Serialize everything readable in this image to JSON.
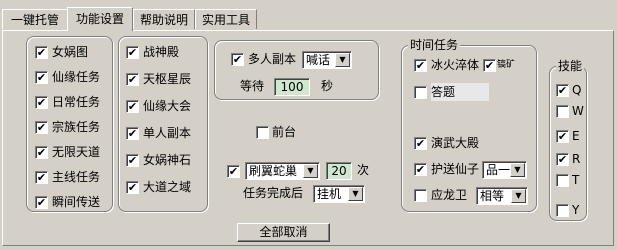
{
  "tabs": [
    "一键托管",
    "功能设置",
    "帮助说明",
    "实用工具"
  ],
  "col1": [
    {
      "label": "女娲图",
      "checked": true
    },
    {
      "label": "仙缘任务",
      "checked": true
    },
    {
      "label": "日常任务",
      "checked": true
    },
    {
      "label": "宗族任务",
      "checked": true
    },
    {
      "label": "无限天道",
      "checked": true
    },
    {
      "label": "主线任务",
      "checked": true
    },
    {
      "label": "瞬间传送",
      "checked": true
    }
  ],
  "col2": [
    {
      "label": "战神殿",
      "checked": true
    },
    {
      "label": "天枢星辰",
      "checked": true
    },
    {
      "label": "仙缘大会",
      "checked": true
    },
    {
      "label": "单人副本",
      "checked": true
    },
    {
      "label": "女娲神石",
      "checked": true
    },
    {
      "label": "大道之域",
      "checked": true
    }
  ],
  "dungeon": {
    "label": "多人副本",
    "checked": true,
    "mode_value": "喊话",
    "wait_label": "等待",
    "wait_value": "100",
    "seconds_label": "秒"
  },
  "arena": {
    "label": "前台",
    "checked": false
  },
  "farm": {
    "checked": true,
    "target_value": "刷翼蛇巢",
    "count_value": "20",
    "count_suffix": "次",
    "after_label": "任务完成后",
    "after_value": "挂机"
  },
  "time_tasks": {
    "title": "时间任务",
    "ice_fire": {
      "label": "冰火淬体",
      "checked": true,
      "sub_label": "镐矿",
      "sub_checked": true
    },
    "quiz": {
      "label": "答题",
      "checked": false
    },
    "martial": {
      "label": "演武大殿",
      "checked": true
    },
    "escort": {
      "label": "护送仙子",
      "checked": true,
      "grade_value": "品一"
    },
    "guard": {
      "label": "应龙卫",
      "checked": false,
      "level_value": "相等"
    }
  },
  "skills": {
    "title": "技能",
    "items": [
      {
        "key": "Q",
        "checked": true
      },
      {
        "key": "W",
        "checked": false
      },
      {
        "key": "E",
        "checked": true
      },
      {
        "key": "R",
        "checked": true
      },
      {
        "key": "T",
        "checked": false
      },
      {
        "key": "Y",
        "checked": false
      }
    ]
  },
  "cancel_all_label": "全部取消"
}
